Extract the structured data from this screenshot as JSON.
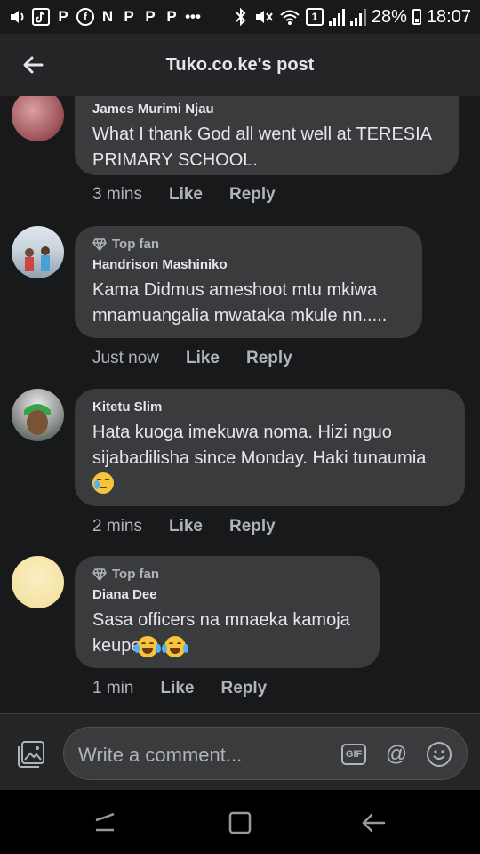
{
  "status_bar": {
    "battery_percent": "28%",
    "time": "18:07"
  },
  "header": {
    "title": "Tuko.co.ke's post"
  },
  "comments": [
    {
      "author": "James Murimi Njau",
      "top_fan": false,
      "text": "What I thank God all went well at TERESIA PRIMARY SCHOOL.",
      "time": "3 mins",
      "like": "Like",
      "reply": "Reply"
    },
    {
      "author": "Handrison Mashiniko",
      "top_fan": true,
      "badge": "Top fan",
      "text": "Kama Didmus ameshoot mtu mkiwa mnamuangalia mwataka mkule nn.....",
      "time": "Just now",
      "like": "Like",
      "reply": "Reply"
    },
    {
      "author": "Kitetu Slim",
      "top_fan": false,
      "text": "Hata kuoga imekuwa noma. Hizi nguo sijabadilisha since Monday. Haki tunaumia",
      "emoji": "crying-face",
      "time": "2 mins",
      "like": "Like",
      "reply": "Reply"
    },
    {
      "author": "Diana Dee",
      "top_fan": true,
      "badge": "Top fan",
      "text": "Sasa officers na mnaeka kamoja keupe",
      "emoji": "tears-of-joy x2",
      "time": "1 min",
      "like": "Like",
      "reply": "Reply"
    }
  ],
  "composer": {
    "placeholder": "Write a comment...",
    "gif_label": "GIF",
    "at_label": "@"
  },
  "colors": {
    "background": "#18191a",
    "bubble": "#3a3b3c",
    "header": "#242526",
    "secondary_text": "#b0b3b8"
  },
  "icons": [
    "back-arrow-icon",
    "gem-icon",
    "photo-icon",
    "gif-icon",
    "mention-icon",
    "smiley-icon",
    "recents-icon",
    "home-icon",
    "back-nav-icon"
  ]
}
